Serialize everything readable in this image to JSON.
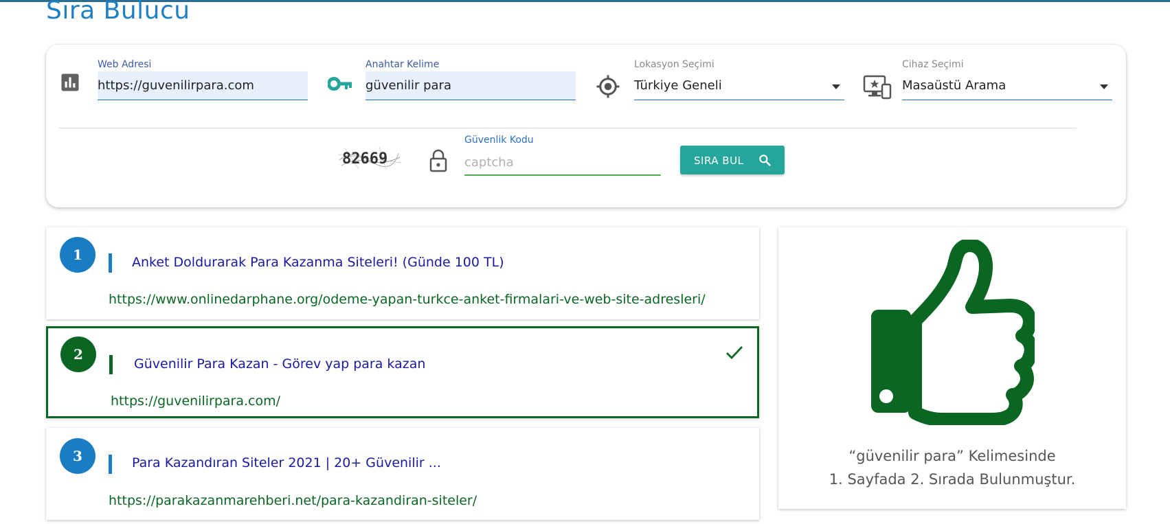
{
  "page": {
    "title": "Sıra Bulucu"
  },
  "form": {
    "web_address": {
      "label": "Web Adresi",
      "value": "https://guvenilirpara.com"
    },
    "keyword": {
      "label": "Anahtar Kelime",
      "value": "güvenilir para"
    },
    "location": {
      "label": "Lokasyon Seçimi",
      "value": "Türkiye Geneli"
    },
    "device": {
      "label": "Cihaz Seçimi",
      "value": "Masaüstü Arama"
    },
    "captcha": {
      "image_text": "82669",
      "label": "Güvenlik Kodu",
      "placeholder": "captcha"
    },
    "search_button": {
      "label": "SIRA BUL"
    }
  },
  "results": [
    {
      "rank": "1",
      "title": "Anket Doldurarak Para Kazanma Siteleri! (Günde 100 TL)",
      "url": "https://www.onlinedarphane.org/odeme-yapan-turkce-anket-firmalari-ve-web-site-adresleri/"
    },
    {
      "rank": "2",
      "title": "Güvenilir Para Kazan - Görev yap para kazan",
      "url": "https://guvenilirpara.com/"
    },
    {
      "rank": "3",
      "title": "Para Kazandıran Siteler 2021 | 20+ Güvenilir ...",
      "url": "https://parakazanmarehberi.net/para-kazandiran-siteler/"
    }
  ],
  "summary": {
    "line1": "“güvenilir para” Kelimesinde",
    "line2": "1. Sayfada 2. Sırada Bulunmuştur."
  },
  "colors": {
    "accent_blue": "#1a7dc4",
    "teal": "#26a69a",
    "success_green": "#0b6623",
    "link_title": "#1a1aa0"
  },
  "icons": [
    "bar-chart-icon",
    "key-icon",
    "location-target-icon",
    "devices-icon",
    "lock-icon",
    "search-icon",
    "check-icon",
    "thumbs-up-icon"
  ]
}
